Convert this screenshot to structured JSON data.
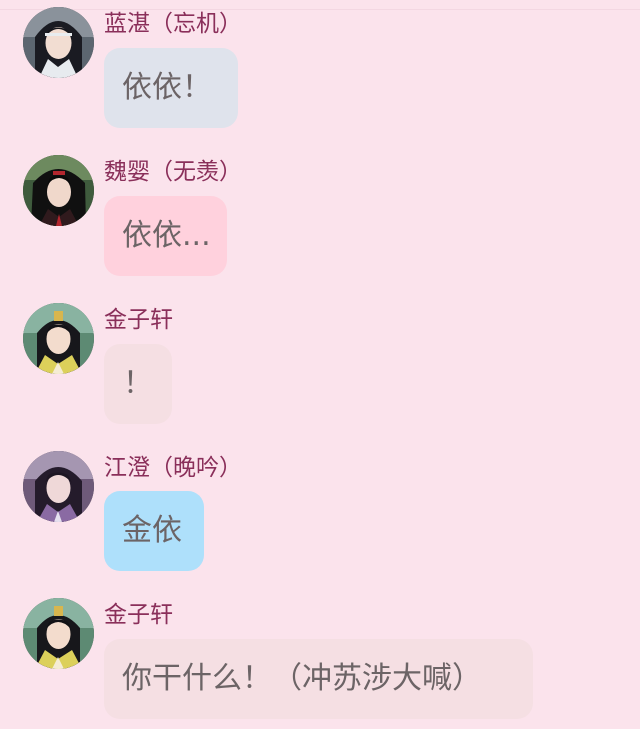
{
  "messages": [
    {
      "sender": "蓝湛（忘机）",
      "text": "依依！",
      "bubble_color": "#dfe3ec",
      "avatar": "lan-zhan-avatar"
    },
    {
      "sender": "魏婴（无羡）",
      "text": "依依...",
      "bubble_color": "#ffd1dd",
      "avatar": "wei-ying-avatar"
    },
    {
      "sender": "金子轩",
      "text": "！",
      "bubble_color": "#f5dfe3",
      "avatar": "jin-zixuan-avatar"
    },
    {
      "sender": "江澄（晚吟）",
      "text": "金依",
      "bubble_color": "#aee0fb",
      "avatar": "jiang-cheng-avatar"
    },
    {
      "sender": "金子轩",
      "text": "你干什么！（冲苏涉大喊）",
      "bubble_color": "#f5dfe3",
      "avatar": "jin-zixuan-avatar"
    }
  ]
}
